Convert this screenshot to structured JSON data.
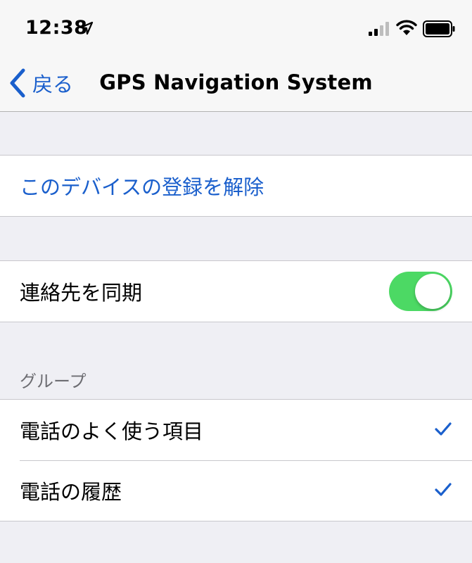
{
  "status_bar": {
    "time": "12:38",
    "icons": [
      "location-arrow-icon",
      "cellular-signal-icon",
      "wifi-icon",
      "battery-icon"
    ]
  },
  "nav": {
    "back_label": "戻る",
    "title": "GPS Navigation System"
  },
  "device": {
    "unregister_label": "このデバイスの登録を解除"
  },
  "sync": {
    "contacts_label": "連絡先を同期",
    "contacts_enabled": true
  },
  "groups": {
    "header": "グループ",
    "items": [
      {
        "label": "電話のよく使う項目",
        "checked": true
      },
      {
        "label": "電話の履歴",
        "checked": true
      }
    ]
  },
  "colors": {
    "accent": "#1a5fcc",
    "toggle_on": "#4cd964",
    "background": "#efeff4"
  }
}
